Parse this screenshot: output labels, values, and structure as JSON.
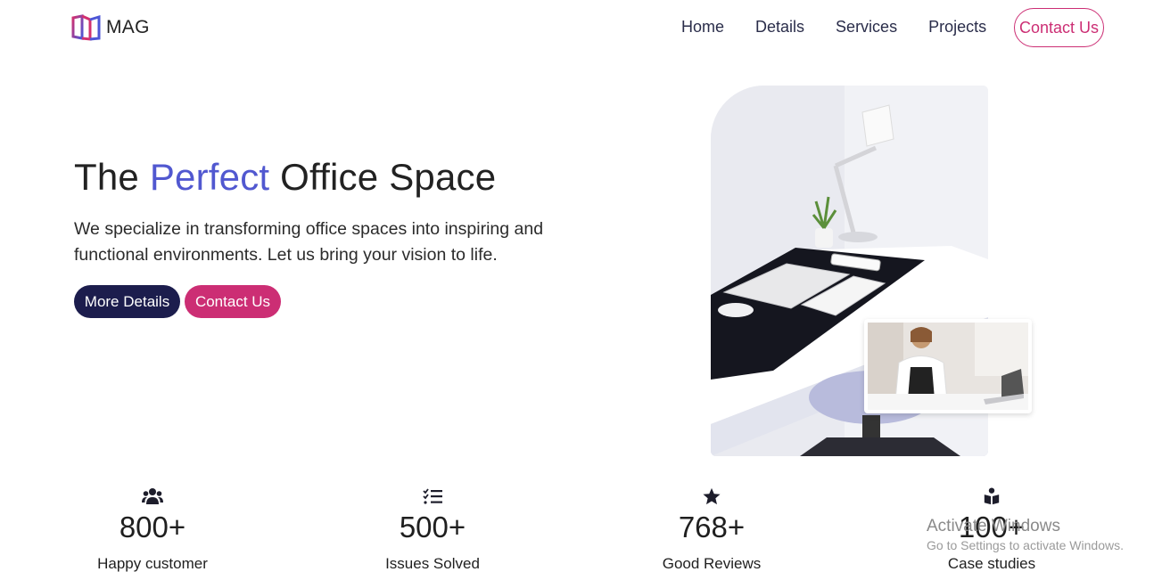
{
  "brand": {
    "name": "MAG"
  },
  "nav": {
    "links": [
      "Home",
      "Details",
      "Services",
      "Projects"
    ],
    "cta": "Contact Us"
  },
  "hero": {
    "title_pre": "The ",
    "title_accent": "Perfect",
    "title_post": " Office Space",
    "description": "We specialize in transforming office spaces into inspiring and functional environments. Let us bring your vision to life.",
    "primary_button": "More Details",
    "secondary_button": "Contact Us"
  },
  "stats": [
    {
      "icon": "users-icon",
      "number": "800+",
      "label": "Happy customer"
    },
    {
      "icon": "checklist-icon",
      "number": "500+",
      "label": "Issues Solved"
    },
    {
      "icon": "star-icon",
      "number": "768+",
      "label": "Good Reviews"
    },
    {
      "icon": "book-reader-icon",
      "number": "100+",
      "label": "Case studies"
    }
  ],
  "watermark": {
    "title": "Activate Windows",
    "subtitle": "Go to Settings to activate Windows."
  },
  "colors": {
    "accent_blue": "#5158d0",
    "accent_pink": "#cc2e74",
    "navy": "#1c1d4d"
  }
}
